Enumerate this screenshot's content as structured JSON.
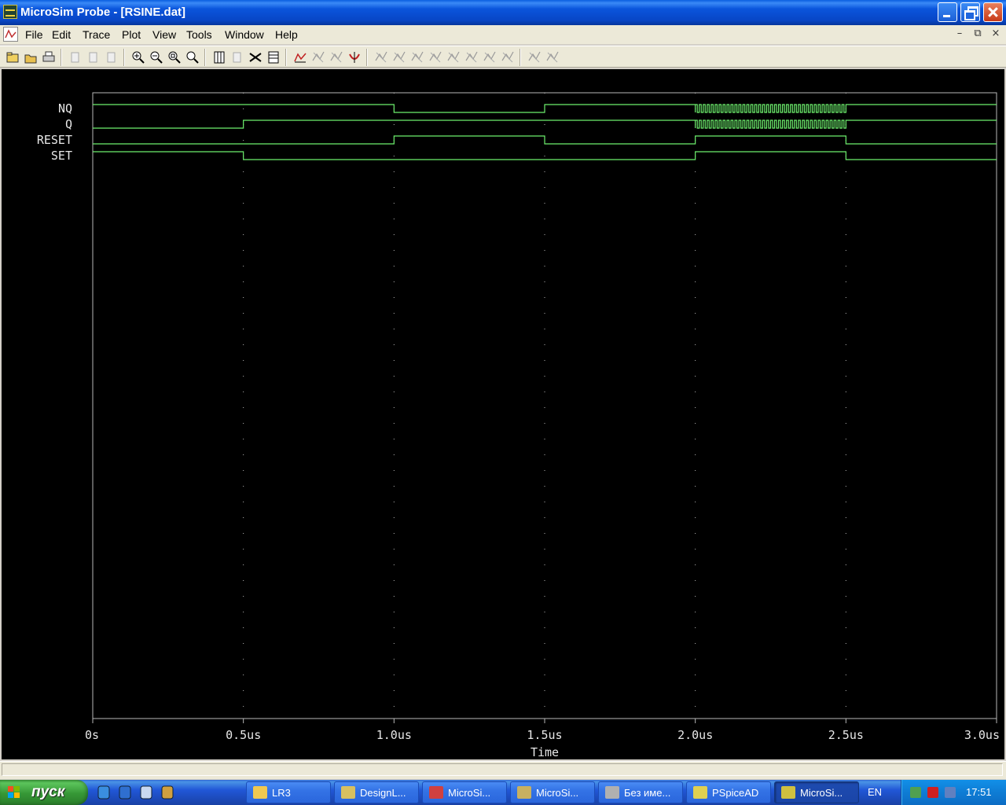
{
  "window": {
    "title": "MicroSim Probe - [RSINE.dat]"
  },
  "menu": [
    "File",
    "Edit",
    "Trace",
    "Plot",
    "View",
    "Tools",
    "Window",
    "Help"
  ],
  "mdi_controls": {
    "minimize": "–",
    "restore": "⧉",
    "close": "×"
  },
  "toolbar": {
    "groups": [
      [
        "open-file",
        "open-folder",
        "print"
      ],
      [
        "cut",
        "copy",
        "paste"
      ],
      [
        "zoom-in",
        "zoom-out",
        "zoom-area",
        "zoom-fit"
      ],
      [
        "axis",
        "plot-add",
        "add-trace",
        "table"
      ],
      [
        "fft",
        "cursor-trace",
        "cursor-peak",
        "cursor-mark"
      ],
      [
        "cursor-slope",
        "cursor-min",
        "cursor-max",
        "cursor-pt",
        "cursor-search",
        "cursor-next",
        "cursor-prev",
        "cursor-label"
      ],
      [
        "mark-label",
        "mark-point"
      ]
    ]
  },
  "chart_data": {
    "type": "digital-waveform",
    "x_unit": "us",
    "xlabel": "Time",
    "xlim": [
      0,
      3.0
    ],
    "x_ticks": [
      0,
      0.5,
      1.0,
      1.5,
      2.0,
      2.5,
      3.0
    ],
    "x_tick_labels": [
      "0s",
      "0.5us",
      "1.0us",
      "1.5us",
      "2.0us",
      "2.5us",
      "3.0us"
    ],
    "grid": true,
    "trace_color": "#6ef06e",
    "grid_color": "#b8b8b8",
    "background": "#000000",
    "series": [
      {
        "name": "NQ",
        "segments": [
          [
            0,
            1.0,
            1
          ],
          [
            1.0,
            1.5,
            0
          ],
          [
            1.5,
            2.0,
            1
          ],
          [
            2.0,
            2.5,
            "osc"
          ],
          [
            2.5,
            3.0,
            1
          ]
        ]
      },
      {
        "name": "Q",
        "segments": [
          [
            0,
            0.5,
            0
          ],
          [
            0.5,
            2.0,
            1
          ],
          [
            2.0,
            2.5,
            "osc"
          ],
          [
            2.5,
            3.0,
            1
          ]
        ]
      },
      {
        "name": "RESET",
        "segments": [
          [
            0,
            1.0,
            0
          ],
          [
            1.0,
            1.5,
            1
          ],
          [
            1.5,
            2.0,
            0
          ],
          [
            2.0,
            2.5,
            1
          ],
          [
            2.5,
            3.0,
            0
          ]
        ]
      },
      {
        "name": "SET",
        "segments": [
          [
            0,
            0.5,
            1
          ],
          [
            0.5,
            2.0,
            0
          ],
          [
            2.0,
            2.5,
            1
          ],
          [
            2.5,
            3.0,
            0
          ]
        ]
      }
    ],
    "oscillation_cycles": 38
  },
  "taskbar": {
    "start_label": "пуск",
    "quick_launch": [
      "ie-icon",
      "browser-icon",
      "notepad-icon",
      "tool-icon"
    ],
    "tasks": [
      {
        "label": "LR3",
        "icon_color": "#f0c850",
        "active": false
      },
      {
        "label": "DesignL...",
        "icon_color": "#d8c060",
        "active": false
      },
      {
        "label": "MicroSi...",
        "icon_color": "#d04040",
        "active": false
      },
      {
        "label": "MicroSi...",
        "icon_color": "#c8b060",
        "active": false
      },
      {
        "label": "Без име...",
        "icon_color": "#b0b0b0",
        "active": false
      },
      {
        "label": "PSpiceAD",
        "icon_color": "#e0d050",
        "active": false
      },
      {
        "label": "MicroSi...",
        "icon_color": "#d0c040",
        "active": true
      }
    ],
    "language": "EN",
    "tray_icons": [
      "network-icon",
      "antivirus-icon",
      "monitor-icon"
    ],
    "clock": "17:51"
  }
}
